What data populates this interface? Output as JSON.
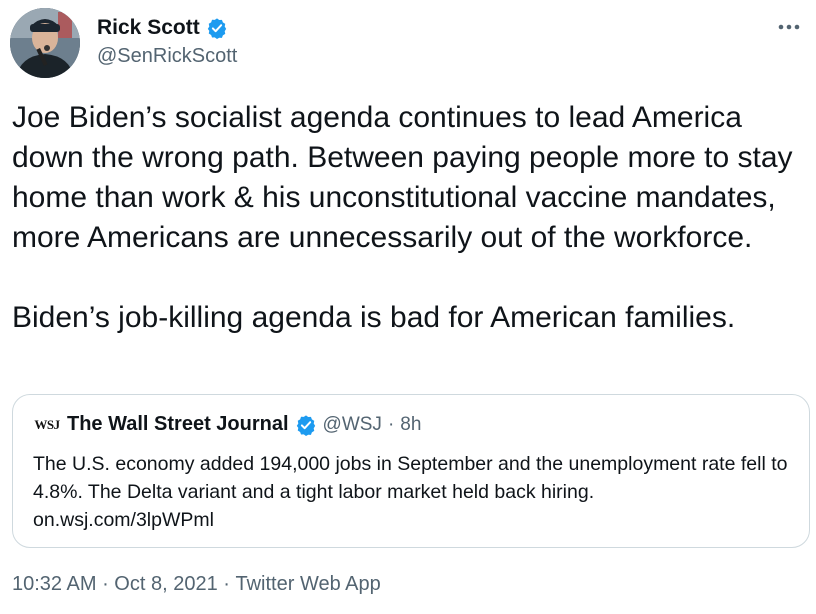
{
  "author": {
    "display_name": "Rick Scott",
    "handle": "@SenRickScott",
    "verified_icon": "verified-badge-icon",
    "avatar_icon": "profile-photo"
  },
  "tweet": {
    "paragraph_1": "Joe Biden’s socialist agenda continues to lead America down the wrong path. Between paying people more to stay home than work & his unconstitutional vaccine mandates, more Americans are unnecessarily out of the workforce.",
    "paragraph_2": "Biden’s job-killing agenda is bad for American families."
  },
  "quoted_tweet": {
    "logo_text": "WSJ",
    "display_name": "The Wall Street Journal",
    "handle": "@WSJ",
    "separator": "·",
    "time_ago": "8h",
    "text": "The U.S. economy added 194,000 jobs in September and the unemployment rate fell to 4.8%. The Delta variant and a tight labor market held back hiring.",
    "link": "on.wsj.com/3lpWPml"
  },
  "footer": {
    "time": "10:32 AM",
    "separator_1": " · ",
    "date": "Oct 8, 2021",
    "separator_2": " · ",
    "source": "Twitter Web App"
  },
  "colors": {
    "verified_blue": "#1d9bf0",
    "secondary_text": "#536471",
    "border": "#cfd9de",
    "primary_text": "#0f1419"
  }
}
